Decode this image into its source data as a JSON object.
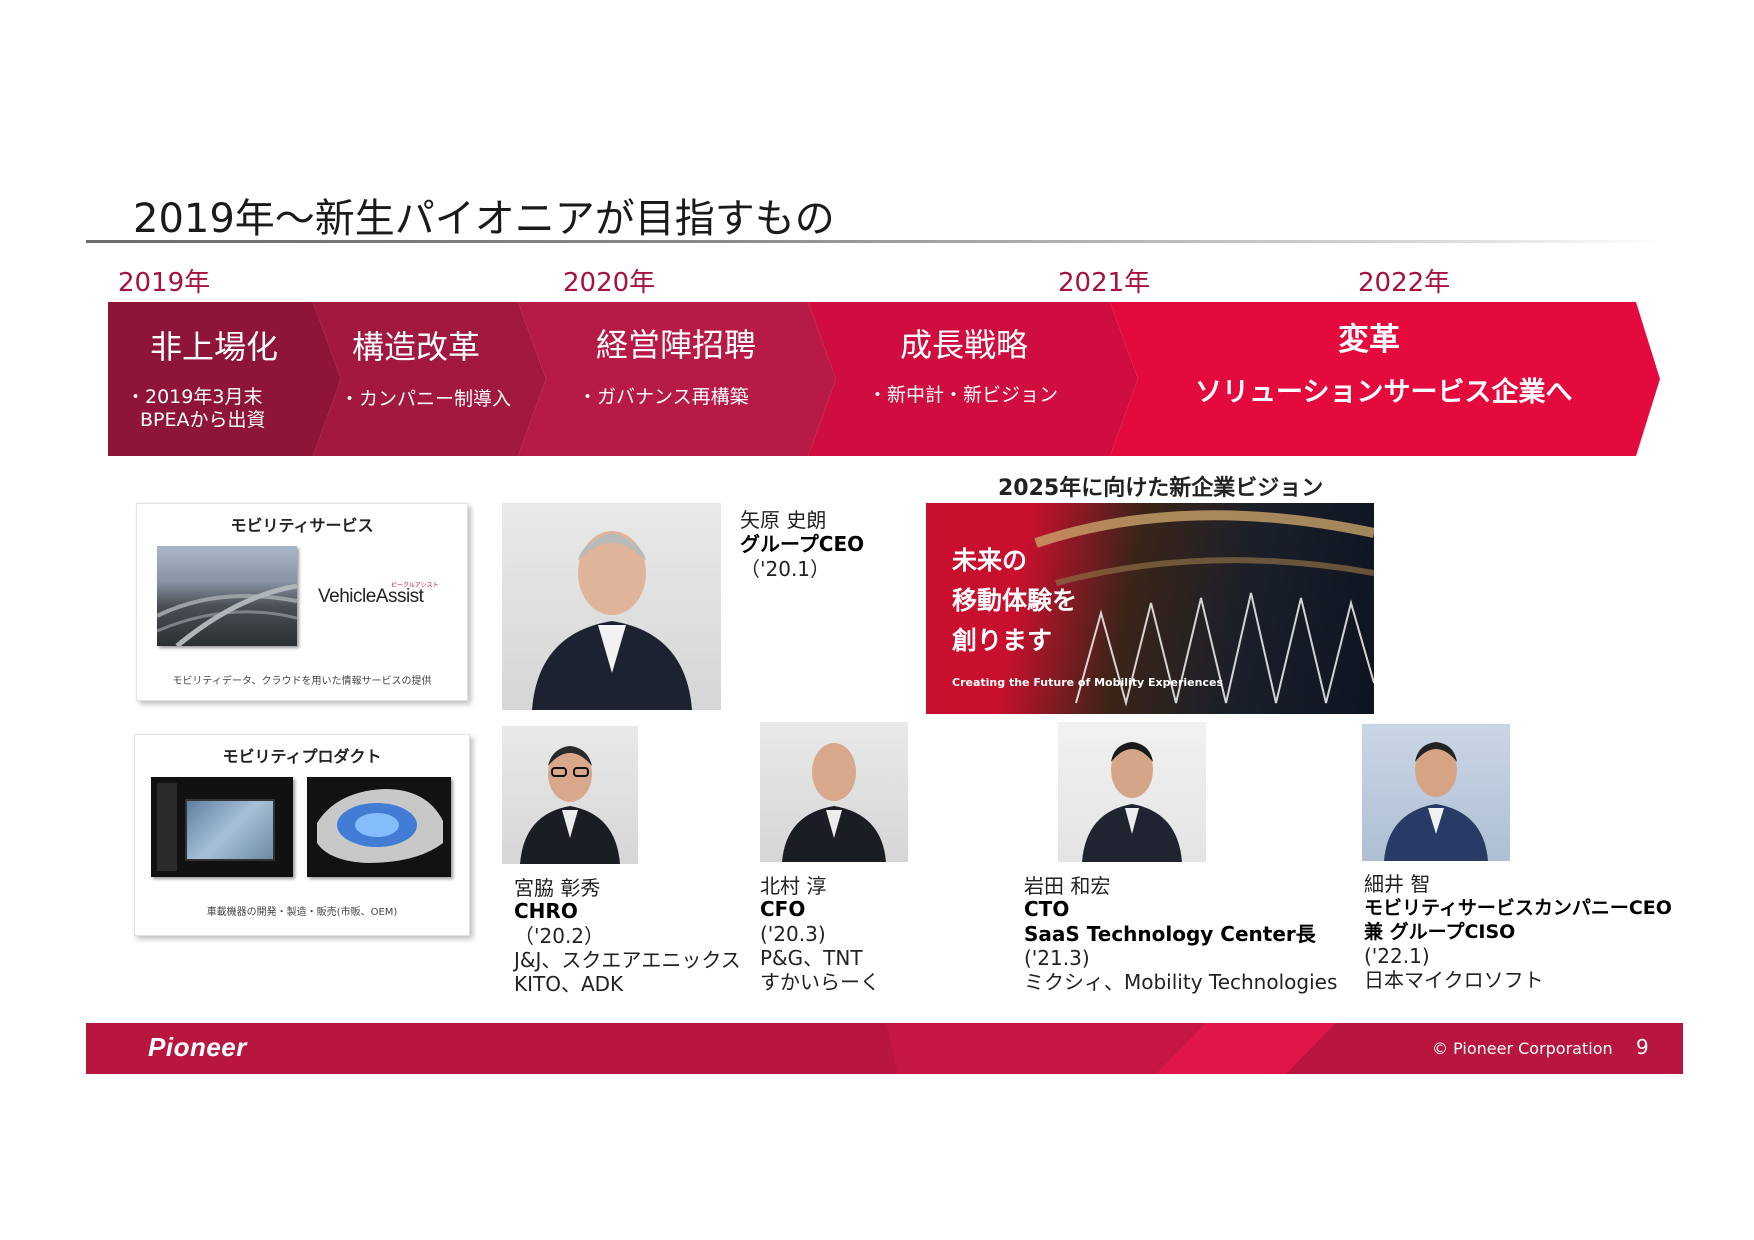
{
  "page": {
    "title": "2019年～新生パイオニアが目指すもの",
    "page_number": "9",
    "copyright": "© Pioneer Corporation",
    "logo_text": "Pioneer"
  },
  "timeline": {
    "years": [
      "2019年",
      "2020年",
      "2021年",
      "2022年"
    ],
    "phases": [
      {
        "title": "非上場化",
        "sub": [
          "・2019年3月末",
          "BPEAから出資"
        ],
        "color": "#8e1538"
      },
      {
        "title": "構造改革",
        "sub": [
          "・カンパニー制導入"
        ],
        "color": "#a2183f"
      },
      {
        "title": "経営陣招聘",
        "sub": [
          "・ガバナンス再構築"
        ],
        "color": "#b71a44"
      },
      {
        "title": "成長戦略",
        "sub": [
          "・新中計・新ビジョン"
        ],
        "color": "#cf0e3f"
      },
      {
        "title": "変革",
        "sub": [
          "ソリューションサービス企業へ"
        ],
        "color": "#e40a3e"
      }
    ]
  },
  "cards": {
    "service": {
      "title": "モビリティサービス",
      "brand": "VehicleAssist",
      "brand_kana": "ビークルアシスト",
      "caption": "モビリティデータ、クラウドを用いた情報サービスの提供"
    },
    "product": {
      "title": "モビリティプロダクト",
      "caption": "車載機器の開発・製造・販売(市販、OEM)"
    }
  },
  "vision": {
    "heading": "2025年に向けた新企業ビジョン",
    "lines": [
      "未来の",
      "移動体験を",
      "創ります"
    ],
    "tagline": "Creating the Future of Mobility Experiences"
  },
  "people": {
    "ceo": {
      "name": "矢原 史朗",
      "role": [
        "グループCEO"
      ],
      "lines": [
        "（'20.1）"
      ]
    },
    "chro": {
      "name": "宮脇 彰秀",
      "role": [
        "CHRO"
      ],
      "lines": [
        "（'20.2）",
        "J&J、スクエアエニックス",
        "KITO、ADK"
      ]
    },
    "cfo": {
      "name": "北村 淳",
      "role": [
        "CFO"
      ],
      "lines": [
        "('20.3)",
        "P&G、TNT",
        "すかいらーく"
      ]
    },
    "cto": {
      "name": "岩田 和宏",
      "role": [
        "CTO",
        "SaaS Technology Center長"
      ],
      "lines": [
        "('21.3)",
        "ミクシィ、Mobility Technologies"
      ]
    },
    "ciso": {
      "name": "細井 智",
      "role": [
        "モビリティサービスカンパニーCEO",
        "兼 グループCISO"
      ],
      "lines": [
        "('22.1)",
        "日本マイクロソフト"
      ]
    }
  }
}
